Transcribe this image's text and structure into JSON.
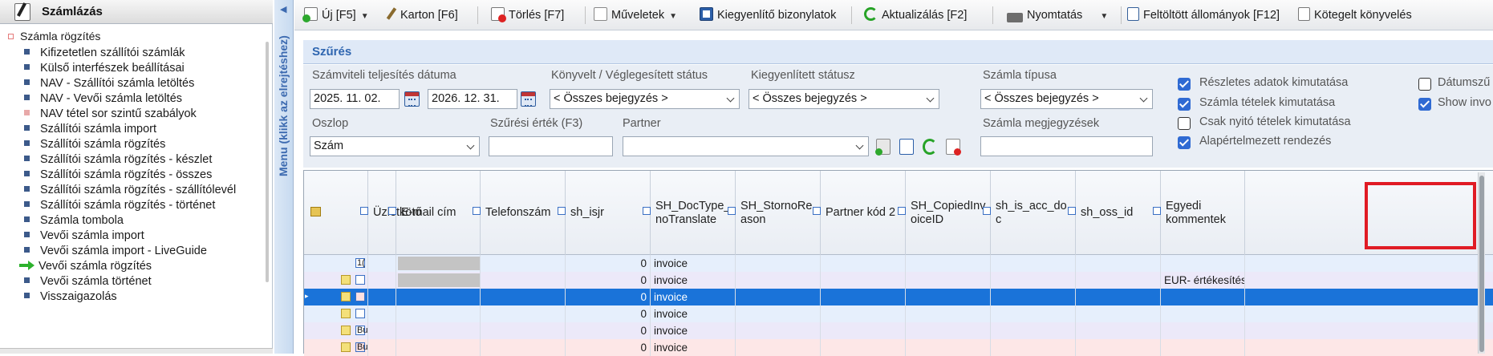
{
  "sidebar": {
    "title": "Számlázás",
    "root": "Számla rögzítés",
    "items": [
      {
        "label": "Kifizetetlen szállítói számlák",
        "marker": "bullet"
      },
      {
        "label": "Külső interfészek beállításai",
        "marker": "bullet"
      },
      {
        "label": "NAV - Szállítói számla letöltés",
        "marker": "bullet"
      },
      {
        "label": "NAV - Vevői számla letöltés",
        "marker": "bullet"
      },
      {
        "label": "NAV tétel sor szintű szabályok",
        "marker": "pink"
      },
      {
        "label": "Szállítói számla import",
        "marker": "bullet"
      },
      {
        "label": "Szállítói számla rögzítés",
        "marker": "bullet"
      },
      {
        "label": "Szállítói számla rögzítés - készlet",
        "marker": "bullet"
      },
      {
        "label": "Szállítói számla rögzítés - összes",
        "marker": "bullet"
      },
      {
        "label": "Szállítói számla rögzítés - szállítólevél",
        "marker": "bullet"
      },
      {
        "label": "Szállítói számla rögzítés - történet",
        "marker": "bullet"
      },
      {
        "label": "Számla tombola",
        "marker": "bullet"
      },
      {
        "label": "Vevői számla import",
        "marker": "bullet"
      },
      {
        "label": "Vevői számla import - LiveGuide",
        "marker": "bullet"
      },
      {
        "label": "Vevői számla rögzítés",
        "marker": "arrow"
      },
      {
        "label": "Vevői számla történet",
        "marker": "bullet"
      },
      {
        "label": "Visszaigazolás",
        "marker": "bullet"
      }
    ]
  },
  "menu_bar": {
    "label": "Menu (klikk az elrejtéshez)"
  },
  "toolbar": {
    "new": "Új [F5]",
    "card": "Karton [F6]",
    "delete": "Törlés [F7]",
    "operations": "Műveletek",
    "balancing": "Kiegyenlítő bizonylatok",
    "refresh": "Aktualizálás [F2]",
    "print": "Nyomtatás",
    "uploaded": "Feltöltött állományok [F12]",
    "batch": "Kötegelt könyvelés"
  },
  "filter": {
    "title": "Szűrés",
    "date_label": "Számviteli teljesítés dátuma",
    "date_from": "2025. 11. 02.",
    "date_to": "2026. 12. 31.",
    "booked_label": "Könyvelt / Véglegesített státus",
    "booked_value": "< Összes bejegyzés >",
    "settled_label": "Kiegyenlített státusz",
    "settled_value": "< Összes bejegyzés >",
    "type_label": "Számla típusa",
    "type_value": "< Összes bejegyzés >",
    "column_label": "Oszlop",
    "column_value": "Szám",
    "filter_value_label": "Szűrési érték (F3)",
    "filter_value": "",
    "partner_label": "Partner",
    "partner_value": "",
    "notes_label": "Számla megjegyzések",
    "notes_value": "",
    "checks": [
      {
        "label": "Részletes adatok kimutatása",
        "checked": true
      },
      {
        "label": "Számla tételek kimutatása",
        "checked": true
      },
      {
        "label": "Csak nyitó tételek kimutatása",
        "checked": false
      },
      {
        "label": "Alapértelmezett rendezés",
        "checked": true
      }
    ],
    "checks_right": [
      {
        "label": "Dátumszű",
        "checked": false
      },
      {
        "label": "Show invo",
        "checked": true
      }
    ]
  },
  "grid": {
    "columns": [
      "Üzletkötő",
      "E-mail cím",
      "Telefonszám",
      "sh_isjr",
      "SH_DocType_\nnoTranslate",
      "SH_StornoRe\nason",
      "Partner kód 2",
      "SH_CopiedInv\noiceID",
      "sh_is_acc_do\nc",
      "sh_oss_id",
      "Egyedi\nkommentek"
    ],
    "rows": [
      {
        "prefix": "1(",
        "sh_isjr": "0",
        "doctype": "invoice",
        "comment": "",
        "style": "blue",
        "email_gray": true
      },
      {
        "prefix": "",
        "sh_isjr": "0",
        "doctype": "invoice",
        "comment": "EUR- értékesítés",
        "style": "lilac",
        "email_gray": true
      },
      {
        "prefix": "",
        "sh_isjr": "0",
        "doctype": "invoice",
        "comment": "",
        "style": "selected",
        "email_gray": false
      },
      {
        "prefix": "",
        "sh_isjr": "0",
        "doctype": "invoice",
        "comment": "",
        "style": "blue",
        "email_gray": false
      },
      {
        "prefix": "Bu",
        "sh_isjr": "0",
        "doctype": "invoice",
        "comment": "",
        "style": "lilac",
        "email_gray": false
      },
      {
        "prefix": "Bu",
        "sh_isjr": "0",
        "doctype": "invoice",
        "comment": "",
        "style": "pink",
        "email_gray": false
      }
    ]
  },
  "colors": {
    "accent": "#2f6ad3",
    "selected_row": "#1a73d9",
    "highlight": "#e01b24"
  }
}
